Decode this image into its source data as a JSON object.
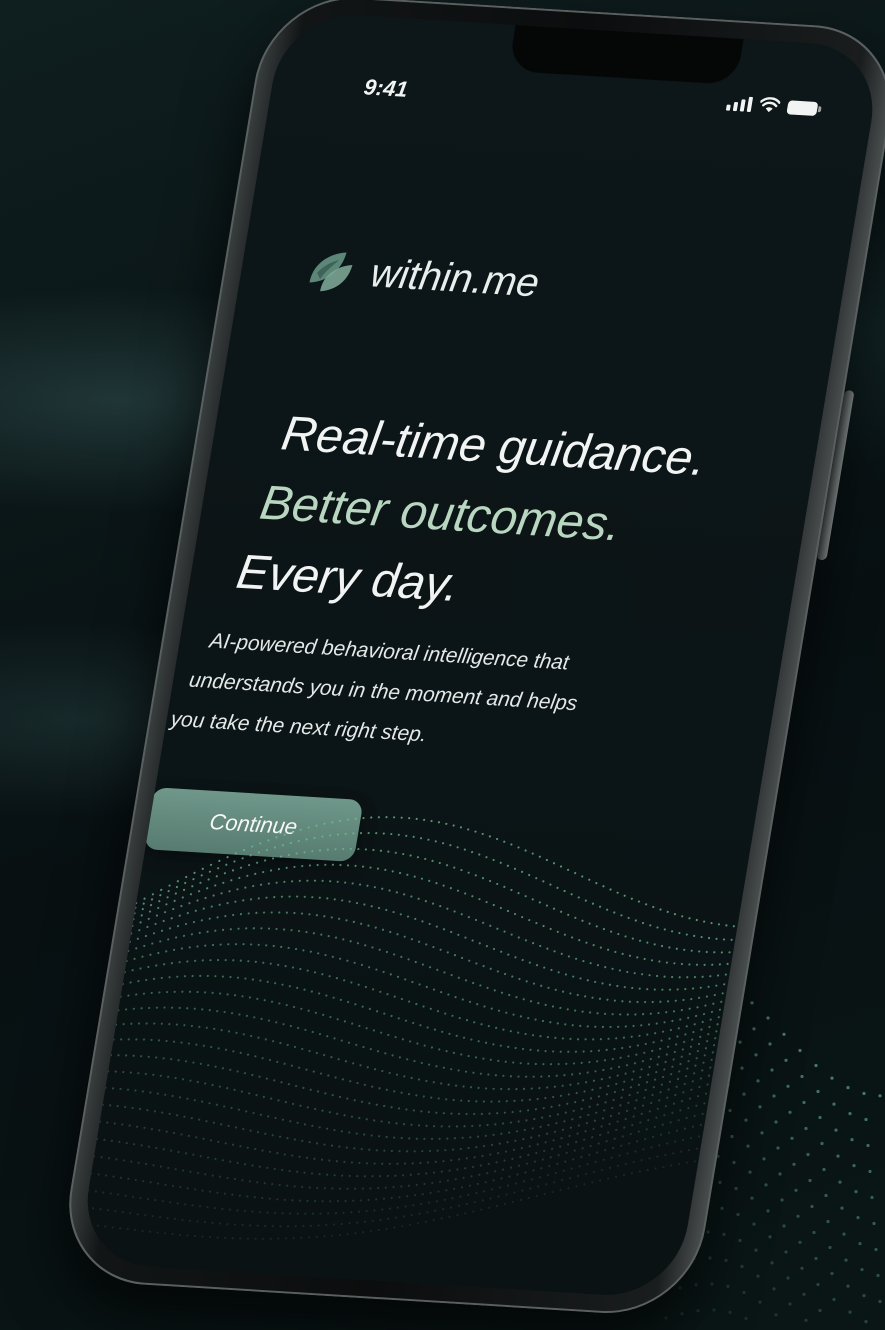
{
  "status_bar": {
    "time": "9:41",
    "icons": [
      "signal-icon",
      "wifi-icon",
      "battery-icon"
    ]
  },
  "brand": {
    "name": "within.me",
    "logo_icon": "leaf-logo-icon"
  },
  "hero": {
    "line1": "Real-time guidance.",
    "line2": "Better outcomes.",
    "line3": "Every day."
  },
  "description": {
    "line1": "AI-powered behavioral intelligence that",
    "line2": "understands you in the moment and helps",
    "line3": "you take the next right step."
  },
  "actions": {
    "continue_label": "Continue"
  },
  "colors": {
    "accent": "#5f8578",
    "accent_text": "#b8d6c0",
    "background": "#0b1416"
  }
}
